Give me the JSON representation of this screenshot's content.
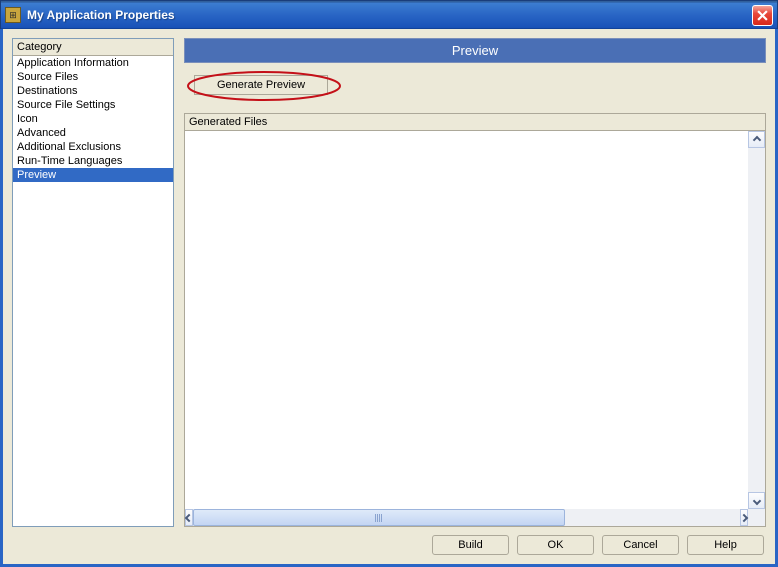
{
  "window": {
    "title": "My Application Properties"
  },
  "sidebar": {
    "header": "Category",
    "items": [
      {
        "label": "Application Information",
        "selected": false
      },
      {
        "label": "Source Files",
        "selected": false
      },
      {
        "label": "Destinations",
        "selected": false
      },
      {
        "label": "Source File Settings",
        "selected": false
      },
      {
        "label": "Icon",
        "selected": false
      },
      {
        "label": "Advanced",
        "selected": false
      },
      {
        "label": "Additional Exclusions",
        "selected": false
      },
      {
        "label": "Run-Time Languages",
        "selected": false
      },
      {
        "label": "Preview",
        "selected": true
      }
    ]
  },
  "main": {
    "title": "Preview",
    "generate_label": "Generate Preview",
    "files_label": "Generated Files"
  },
  "buttons": {
    "build": "Build",
    "ok": "OK",
    "cancel": "Cancel",
    "help": "Help"
  }
}
